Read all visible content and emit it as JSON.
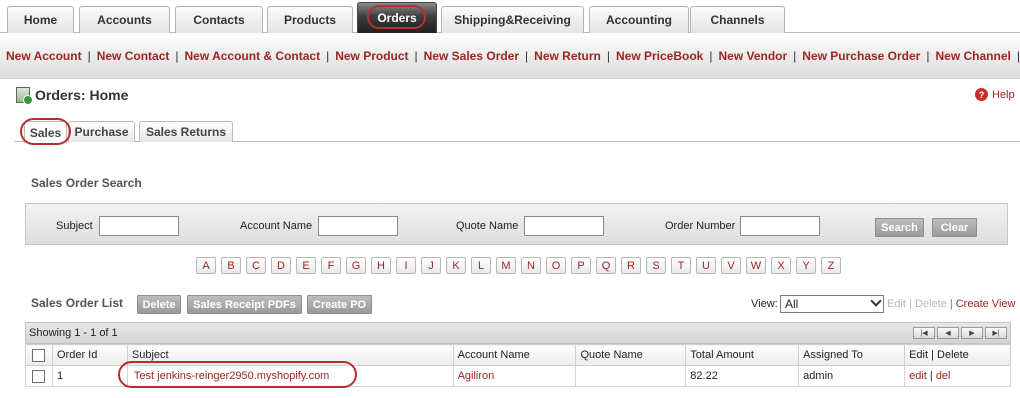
{
  "nav": {
    "tabs": [
      {
        "label": "Home"
      },
      {
        "label": "Accounts"
      },
      {
        "label": "Contacts"
      },
      {
        "label": "Products"
      },
      {
        "label": "Orders",
        "active": true
      },
      {
        "label": "Shipping&Receiving"
      },
      {
        "label": "Accounting"
      },
      {
        "label": "Channels"
      }
    ]
  },
  "quick_links": {
    "items": [
      "New Account",
      "New Contact",
      "New Account & Contact",
      "New Product",
      "New Sales Order",
      "New Return",
      "New PriceBook",
      "New Vendor",
      "New Purchase Order",
      "New Channel"
    ],
    "separator": "|",
    "more": "»"
  },
  "header": {
    "title": "Orders: Home",
    "help": "Help"
  },
  "subtabs": {
    "items": [
      {
        "label": "Sales",
        "active": true
      },
      {
        "label": "Purchase"
      },
      {
        "label": "Sales Returns"
      }
    ]
  },
  "search": {
    "title": "Sales Order Search",
    "fields": [
      {
        "label": "Subject",
        "value": ""
      },
      {
        "label": "Account Name",
        "value": ""
      },
      {
        "label": "Quote Name",
        "value": ""
      },
      {
        "label": "Order Number",
        "value": ""
      }
    ],
    "search_btn": "Search",
    "clear_btn": "Clear"
  },
  "alphabet": [
    "A",
    "B",
    "C",
    "D",
    "E",
    "F",
    "G",
    "H",
    "I",
    "J",
    "K",
    "L",
    "M",
    "N",
    "O",
    "P",
    "Q",
    "R",
    "S",
    "T",
    "U",
    "V",
    "W",
    "X",
    "Y",
    "Z"
  ],
  "list": {
    "title": "Sales Order List",
    "buttons": {
      "delete": "Delete",
      "pdfs": "Sales Receipt PDFs",
      "create_po": "Create PO"
    },
    "view_label": "View:",
    "view_value": "All",
    "edit": "Edit",
    "delete": "Delete",
    "create_view": "Create View",
    "showing": "Showing 1 - 1 of 1",
    "columns": [
      "Order Id",
      "Subject",
      "Account Name",
      "Quote Name",
      "Total Amount",
      "Assigned To",
      "Edit | Delete"
    ],
    "rows": [
      {
        "order_id": "1",
        "subject": "Test jenkins-reinger2950.myshopify.com",
        "account_name": "Agiliron",
        "quote_name": "",
        "total_amount": "82.22",
        "assigned_to": "admin",
        "edit": "edit",
        "del": "del"
      }
    ]
  },
  "colors": {
    "accent": "#9c2621",
    "highlight_circle": "#b5302e"
  }
}
